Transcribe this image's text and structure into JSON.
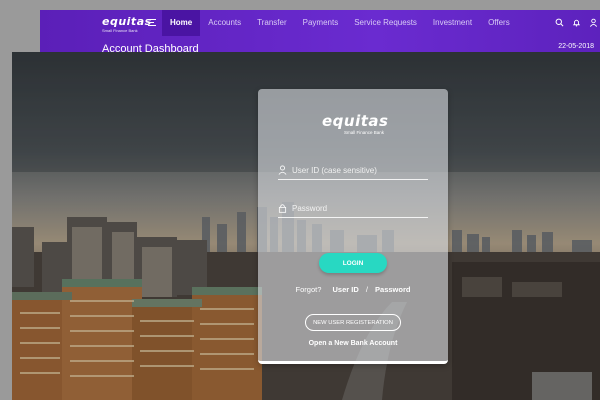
{
  "app": {
    "logo_text": "equitas",
    "logo_sub": "Small Finance Bank",
    "nav": [
      "Home",
      "Accounts",
      "Transfer",
      "Payments",
      "Service Requests",
      "Investment",
      "Offers"
    ],
    "active_nav": "Home",
    "dashboard_title": "Account Dashboard",
    "date": "22-05-2018"
  },
  "login": {
    "logo_text": "equitas",
    "logo_sub": "Small Finance Bank",
    "user_id_placeholder": "User ID (case sensitive)",
    "password_placeholder": "Password",
    "login_label": "LOGIN",
    "forgot_label": "Forgot?",
    "forgot_user_id": "User ID",
    "forgot_sep": "/",
    "forgot_password": "Password",
    "register_label": "NEW USER REGISTERATION",
    "open_account_label": "Open a New Bank Account"
  },
  "colors": {
    "header_purple": "#5b1fb8",
    "login_teal": "#28d8c2"
  }
}
